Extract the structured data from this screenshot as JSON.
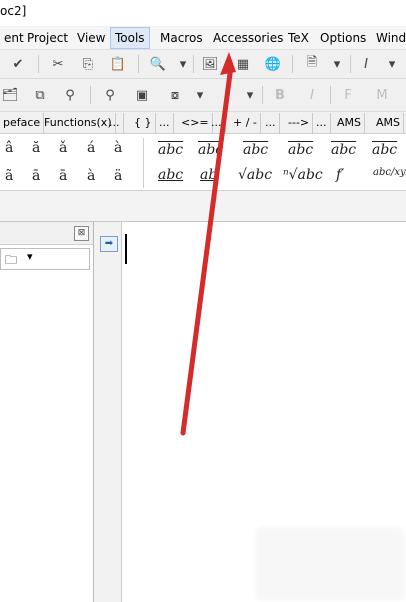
{
  "title": "oc2]",
  "menu": [
    "ent",
    "Project",
    "View",
    "Tools",
    "Macros",
    "Accessories",
    "TeX",
    "Options",
    "Windo"
  ],
  "toolbar_row2": {
    "font_style_labels": [
      "B",
      "I",
      "F",
      "M"
    ]
  },
  "tabs": [
    "peface",
    "Functions(x)",
    "...",
    "{ }",
    "...",
    "<>=",
    "...",
    "+ / -",
    "...",
    "--->",
    "...",
    "AMS",
    "AMS"
  ],
  "symbols": {
    "row1": [
      "â",
      "ă",
      "ǎ",
      "á",
      "à"
    ],
    "row2": [
      "ã",
      "ā",
      "ā",
      "à",
      "ä"
    ],
    "row1_wide": [
      "abc",
      "abc",
      "abc",
      "abc",
      "abc",
      "abc"
    ],
    "row2_wide": [
      "abc",
      "ab",
      "√abc",
      "ⁿ√abc",
      "f′",
      "abc/xyz"
    ]
  },
  "left_panel": {
    "close": "⊠"
  },
  "annotation": {
    "arrow_color": "#d42b2b"
  }
}
